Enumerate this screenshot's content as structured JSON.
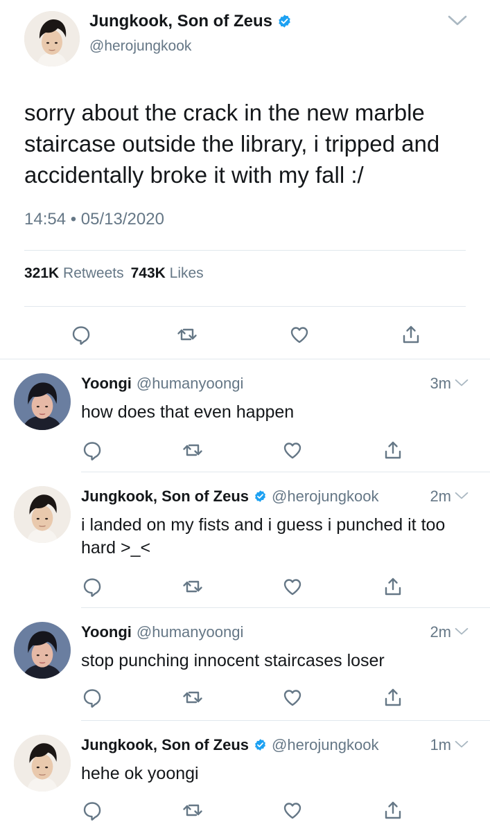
{
  "main_tweet": {
    "author": {
      "name": "Jungkook, Son of Zeus",
      "handle": "@herojungkook",
      "verified": true
    },
    "text": "sorry about the crack in the new marble staircase outside the library, i tripped and accidentally broke it with my fall :/",
    "timestamp": "14:54 • 05/13/2020",
    "retweets_count": "321K",
    "retweets_label": "Retweets",
    "likes_count": "743K",
    "likes_label": "Likes",
    "actions": [
      "reply-icon",
      "retweet-icon",
      "like-icon",
      "share-icon"
    ]
  },
  "replies": [
    {
      "name": "Yoongi",
      "handle": "@humanyoongi",
      "verified": false,
      "time": "3m",
      "text": "how does that even happen"
    },
    {
      "name": "Jungkook, Son of Zeus",
      "handle": "@herojungkook",
      "verified": true,
      "time": "2m",
      "text": "i landed on my fists and i guess i punched it too hard >_<"
    },
    {
      "name": "Yoongi",
      "handle": "@humanyoongi",
      "verified": false,
      "time": "2m",
      "text": "stop punching innocent staircases loser"
    },
    {
      "name": "Jungkook, Son of Zeus",
      "handle": "@herojungkook",
      "verified": true,
      "time": "1m",
      "text": "hehe ok yoongi"
    }
  ],
  "colors": {
    "text_primary": "#14171a",
    "text_secondary": "#657786",
    "verified_blue": "#1da1f2",
    "divider": "#e1e8ed"
  }
}
